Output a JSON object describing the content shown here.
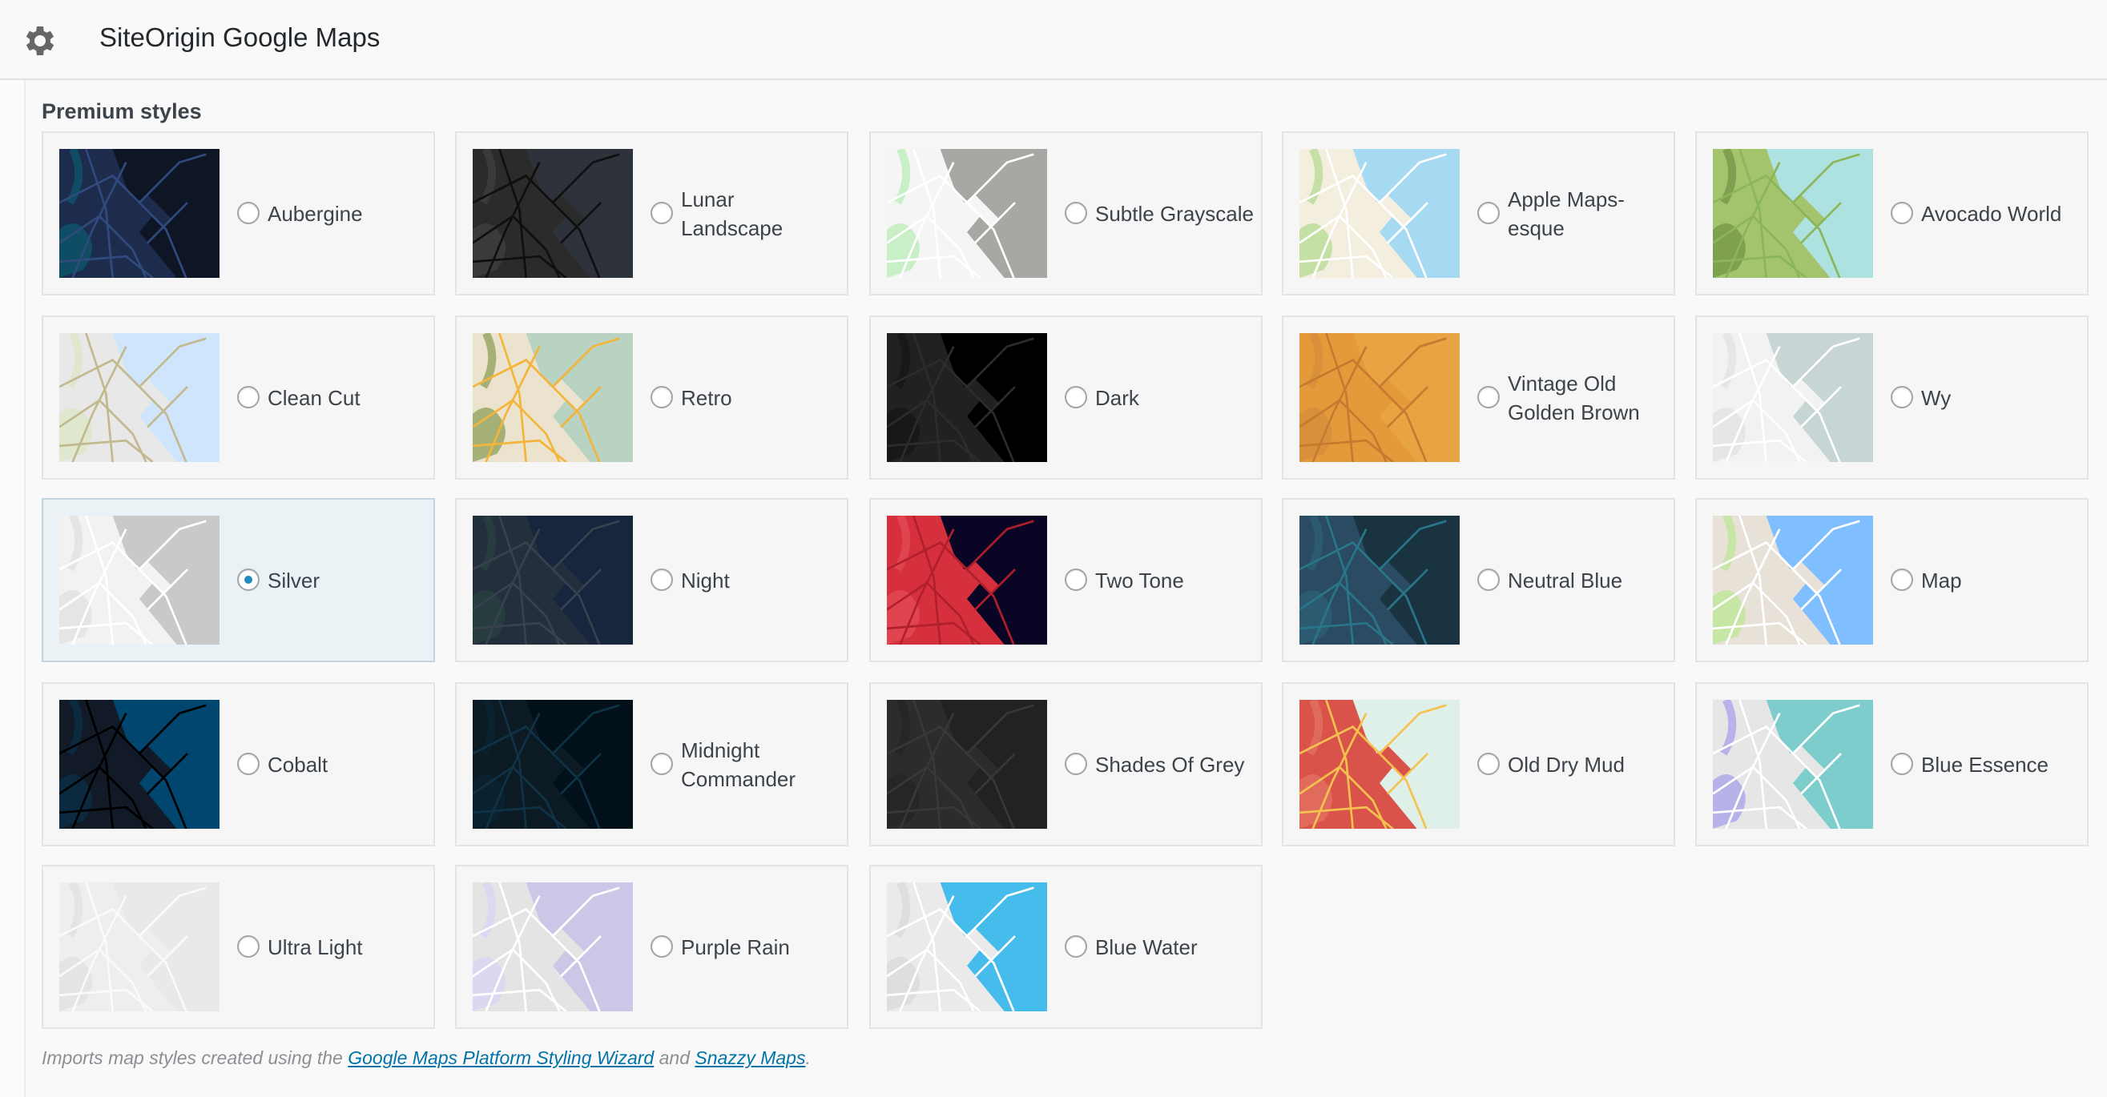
{
  "header": {
    "title": "SiteOrigin Google Maps",
    "icon": "gear-icon"
  },
  "section_title": "Premium styles",
  "selected": "Silver",
  "styles": [
    {
      "name": "Aubergine",
      "colors": {
        "land": "#1d2c4d",
        "water": "#0e1626",
        "road": "#304a7d",
        "park": "#0e4d64"
      }
    },
    {
      "name": "Lunar Landscape",
      "colors": {
        "land": "#2b2b2b",
        "water": "#2e323b",
        "road": "#0f0f0f",
        "park": "#3a3a3a"
      }
    },
    {
      "name": "Subtle Grayscale",
      "colors": {
        "land": "#f5f5f5",
        "water": "#a7a7a4",
        "road": "#ffffff",
        "park": "#c9efc6"
      }
    },
    {
      "name": "Apple Maps-esque",
      "colors": {
        "land": "#f3eedd",
        "water": "#a6d9f2",
        "road": "#ffffff",
        "park": "#c4e0a4"
      }
    },
    {
      "name": "Avocado World",
      "colors": {
        "land": "#a3c46c",
        "water": "#aee2e0",
        "road": "#8cb55a",
        "park": "#7fa14f"
      }
    },
    {
      "name": "Clean Cut",
      "colors": {
        "land": "#e8e8e8",
        "water": "#cfe5fb",
        "road": "#c2b98e",
        "park": "#dfe8cf"
      }
    },
    {
      "name": "Retro",
      "colors": {
        "land": "#ebe3cd",
        "water": "#b9d3c2",
        "road": "#f4b43a",
        "park": "#a5b076"
      }
    },
    {
      "name": "Dark",
      "colors": {
        "land": "#212121",
        "water": "#000000",
        "road": "#2c2c2c",
        "park": "#181818"
      }
    },
    {
      "name": "Vintage Old Golden Brown",
      "colors": {
        "land": "#e49a3a",
        "water": "#e8a442",
        "road": "#c57a30",
        "park": "#d9903a"
      }
    },
    {
      "name": "Wy",
      "colors": {
        "land": "#f2f2f2",
        "water": "#c7d6d5",
        "road": "#ffffff",
        "park": "#e6e6e6"
      }
    },
    {
      "name": "Silver",
      "colors": {
        "land": "#f2f2f2",
        "water": "#c9c9c9",
        "road": "#ffffff",
        "park": "#e5e5e5"
      }
    },
    {
      "name": "Night",
      "colors": {
        "land": "#242f3e",
        "water": "#17263c",
        "road": "#38414e",
        "park": "#263c3f"
      }
    },
    {
      "name": "Two Tone",
      "colors": {
        "land": "#d6303d",
        "water": "#0a0524",
        "road": "#b01f2c",
        "park": "#e0454f"
      }
    },
    {
      "name": "Neutral Blue",
      "colors": {
        "land": "#2b4b63",
        "water": "#193341",
        "road": "#29768a",
        "park": "#2c5a71"
      }
    },
    {
      "name": "Map",
      "colors": {
        "land": "#e8e1d7",
        "water": "#80bfff",
        "road": "#ffffff",
        "park": "#c7e5a5"
      }
    },
    {
      "name": "Cobalt",
      "colors": {
        "land": "#111a26",
        "water": "#00466f",
        "road": "#000000",
        "park": "#0b2a40"
      }
    },
    {
      "name": "Midnight Commander",
      "colors": {
        "land": "#0c1a24",
        "water": "#021019",
        "road": "#0f3246",
        "park": "#0a2230"
      }
    },
    {
      "name": "Shades Of Grey",
      "colors": {
        "land": "#2c2c2c",
        "water": "#222222",
        "road": "#383838",
        "park": "#262626"
      }
    },
    {
      "name": "Old Dry Mud",
      "colors": {
        "land": "#d9534b",
        "water": "#dff0e8",
        "road": "#f3c24f",
        "park": "#e06b5c"
      }
    },
    {
      "name": "Blue Essence",
      "colors": {
        "land": "#e6e6e6",
        "water": "#7dcdcd",
        "road": "#ffffff",
        "park": "#b7b3e8"
      }
    },
    {
      "name": "Ultra Light",
      "colors": {
        "land": "#eeeeee",
        "water": "#e9e9e9",
        "road": "#fafafa",
        "park": "#e4e4e4"
      }
    },
    {
      "name": "Purple Rain",
      "colors": {
        "land": "#e4e4e4",
        "water": "#cac8e6",
        "road": "#ffffff",
        "park": "#dcd8f2"
      }
    },
    {
      "name": "Blue Water",
      "colors": {
        "land": "#eaeaea",
        "water": "#46bcec",
        "road": "#ffffff",
        "park": "#dedede"
      }
    }
  ],
  "footer": {
    "prefix": "Imports map styles created using the ",
    "link1": "Google Maps Platform Styling Wizard",
    "middle": " and ",
    "link2": "Snazzy Maps",
    "suffix": "."
  }
}
